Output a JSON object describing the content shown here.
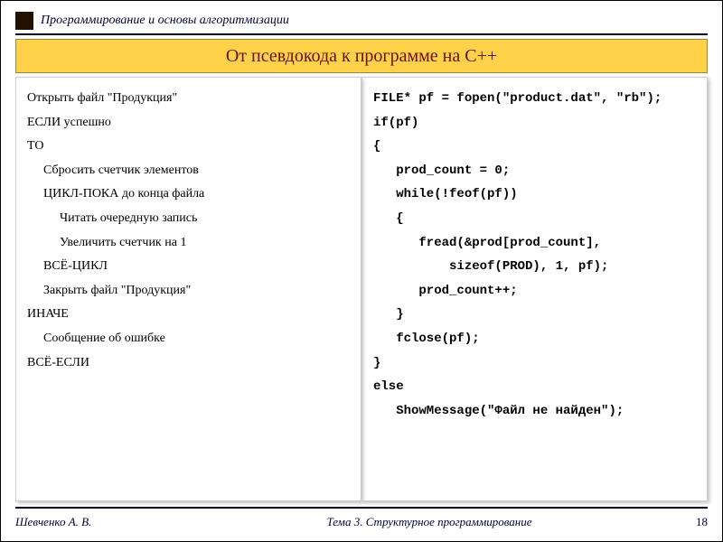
{
  "header": {
    "course_title": "Программирование и основы алгоритмизации"
  },
  "title": "От псевдокода к программе на C++",
  "pseudo": {
    "l0": "Открыть файл \"Продукция\"",
    "l1": "ЕСЛИ успешно",
    "l2": "ТО",
    "l3": "Сбросить счетчик элементов",
    "l4": "ЦИКЛ-ПОКА до конца файла",
    "l5": "Читать очередную запись",
    "l6": "Увеличить счетчик на 1",
    "l7": "ВСЁ-ЦИКЛ",
    "l8": "Закрыть файл \"Продукция\"",
    "l9": "ИНАЧЕ",
    "l10": "Сообщение об ошибке",
    "l11": "ВСЁ-ЕСЛИ"
  },
  "code": {
    "l0": "FILE* pf = fopen(\"product.dat\", \"rb\");",
    "l1": "if(pf)",
    "l2": "{",
    "l3": "   prod_count = 0;",
    "l4": "   while(!feof(pf))",
    "l5": "   {",
    "l6": "      fread(&prod[prod_count],",
    "l7": "          sizeof(PROD), 1, pf);",
    "l8": "      prod_count++;",
    "l9": "   }",
    "l10": "   fclose(pf);",
    "l11": "}",
    "l12": "else",
    "l13": "   ShowMessage(\"Файл не найден\");"
  },
  "footer": {
    "author": "Шевченко А. В.",
    "topic": "Тема 3. Структурное программирование",
    "page": "18"
  }
}
